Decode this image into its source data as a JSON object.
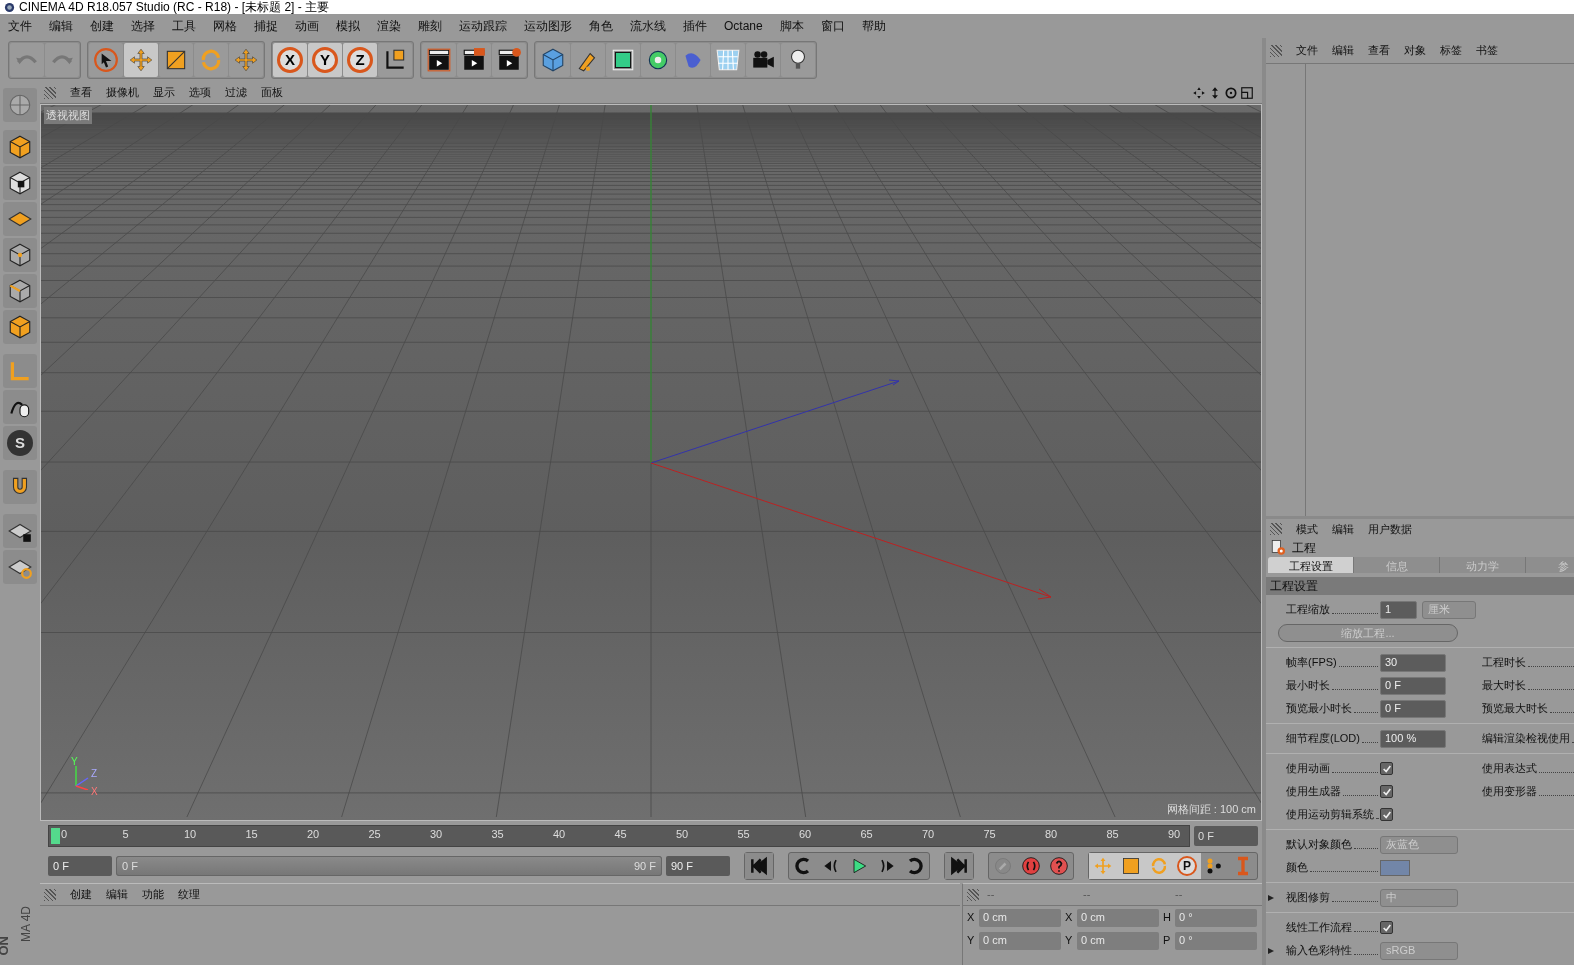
{
  "window": {
    "title": "CINEMA 4D R18.057 Studio (RC - R18) - [未标题 2] - 主要"
  },
  "menu": [
    "文件",
    "编辑",
    "创建",
    "选择",
    "工具",
    "网格",
    "捕捉",
    "动画",
    "模拟",
    "渲染",
    "雕刻",
    "运动跟踪",
    "运动图形",
    "角色",
    "流水线",
    "插件",
    "Octane",
    "脚本",
    "窗口",
    "帮助"
  ],
  "axis_buttons": [
    "X",
    "Y",
    "Z"
  ],
  "left_toolbar_letter": "S",
  "viewport": {
    "menu": [
      "查看",
      "摄像机",
      "显示",
      "选项",
      "过滤",
      "面板"
    ],
    "label": "透视视图",
    "grid_spacing": "网格间距 : 100 cm",
    "gizmo_labels": [
      "Y",
      "Z",
      "X"
    ]
  },
  "timeline": {
    "ticks": [
      "0",
      "5",
      "10",
      "15",
      "20",
      "25",
      "30",
      "35",
      "40",
      "45",
      "50",
      "55",
      "60",
      "65",
      "70",
      "75",
      "80",
      "85",
      "90"
    ],
    "current_frame": "0 F",
    "range": {
      "level": 1,
      "start": "0 F",
      "end": "90 F"
    },
    "end_frame": "90 F",
    "right_frame": "0 F",
    "key_letter": "P"
  },
  "material_panel": {
    "menu": [
      "创建",
      "编辑",
      "功能",
      "纹理"
    ]
  },
  "coordinates": {
    "headers": [
      "--",
      "--",
      "--"
    ],
    "rows": [
      {
        "cells": [
          {
            "axis": "X",
            "value": "0 cm"
          },
          {
            "axis": "X",
            "value": "0 cm"
          },
          {
            "axis": "H",
            "value": "0 °"
          }
        ]
      },
      {
        "cells": [
          {
            "axis": "Y",
            "value": "0 cm"
          },
          {
            "axis": "Y",
            "value": "0 cm"
          },
          {
            "axis": "P",
            "value": "0 °"
          }
        ]
      }
    ]
  },
  "logo_lines": [
    "ON",
    "MA 4D"
  ],
  "object_manager": {
    "menu": [
      "文件",
      "编辑",
      "查看",
      "对象",
      "标签",
      "书签"
    ]
  },
  "attributes": {
    "menu": [
      "模式",
      "编辑",
      "用户数据"
    ],
    "title": "工程",
    "tabs": [
      {
        "label": "工程设置",
        "selected": true
      },
      {
        "label": "信息",
        "selected": false
      },
      {
        "label": "动力学",
        "selected": false
      },
      {
        "label": "参",
        "selected": false
      }
    ],
    "section": "工程设置",
    "groups": [
      [
        {
          "kind": "number",
          "label": "工程缩放",
          "value": "1",
          "unit": "厘米"
        },
        {
          "kind": "button",
          "label": "缩放工程..."
        }
      ],
      [
        {
          "kind": "number",
          "label": "帧率(FPS)",
          "value": "30",
          "right": "工程时长"
        },
        {
          "kind": "number",
          "label": "最小时长",
          "value": "0 F",
          "right": "最大时长"
        },
        {
          "kind": "number",
          "label": "预览最小时长",
          "value": "0 F",
          "right": "预览最大时长"
        }
      ],
      [
        {
          "kind": "number",
          "label": "细节程度(LOD)",
          "value": "100 %",
          "right": "编辑渲染检视使用"
        }
      ],
      [
        {
          "kind": "checkbox",
          "label": "使用动画",
          "checked": true,
          "right": "使用表达式"
        },
        {
          "kind": "checkbox",
          "label": "使用生成器",
          "checked": true,
          "right": "使用变形器"
        },
        {
          "kind": "checkbox",
          "label": "使用运动剪辑系统",
          "checked": true
        }
      ],
      [
        {
          "kind": "dropdown",
          "label": "默认对象颜色",
          "value": "灰蓝色"
        },
        {
          "kind": "color",
          "label": "颜色"
        }
      ],
      [
        {
          "kind": "dropdown",
          "label": "视图修剪",
          "value": "中",
          "expandable": true
        }
      ],
      [
        {
          "kind": "checkbox",
          "label": "线性工作流程",
          "checked": true
        },
        {
          "kind": "dropdown",
          "label": "输入色彩特性",
          "value": "sRGB",
          "expandable": true
        }
      ]
    ]
  }
}
